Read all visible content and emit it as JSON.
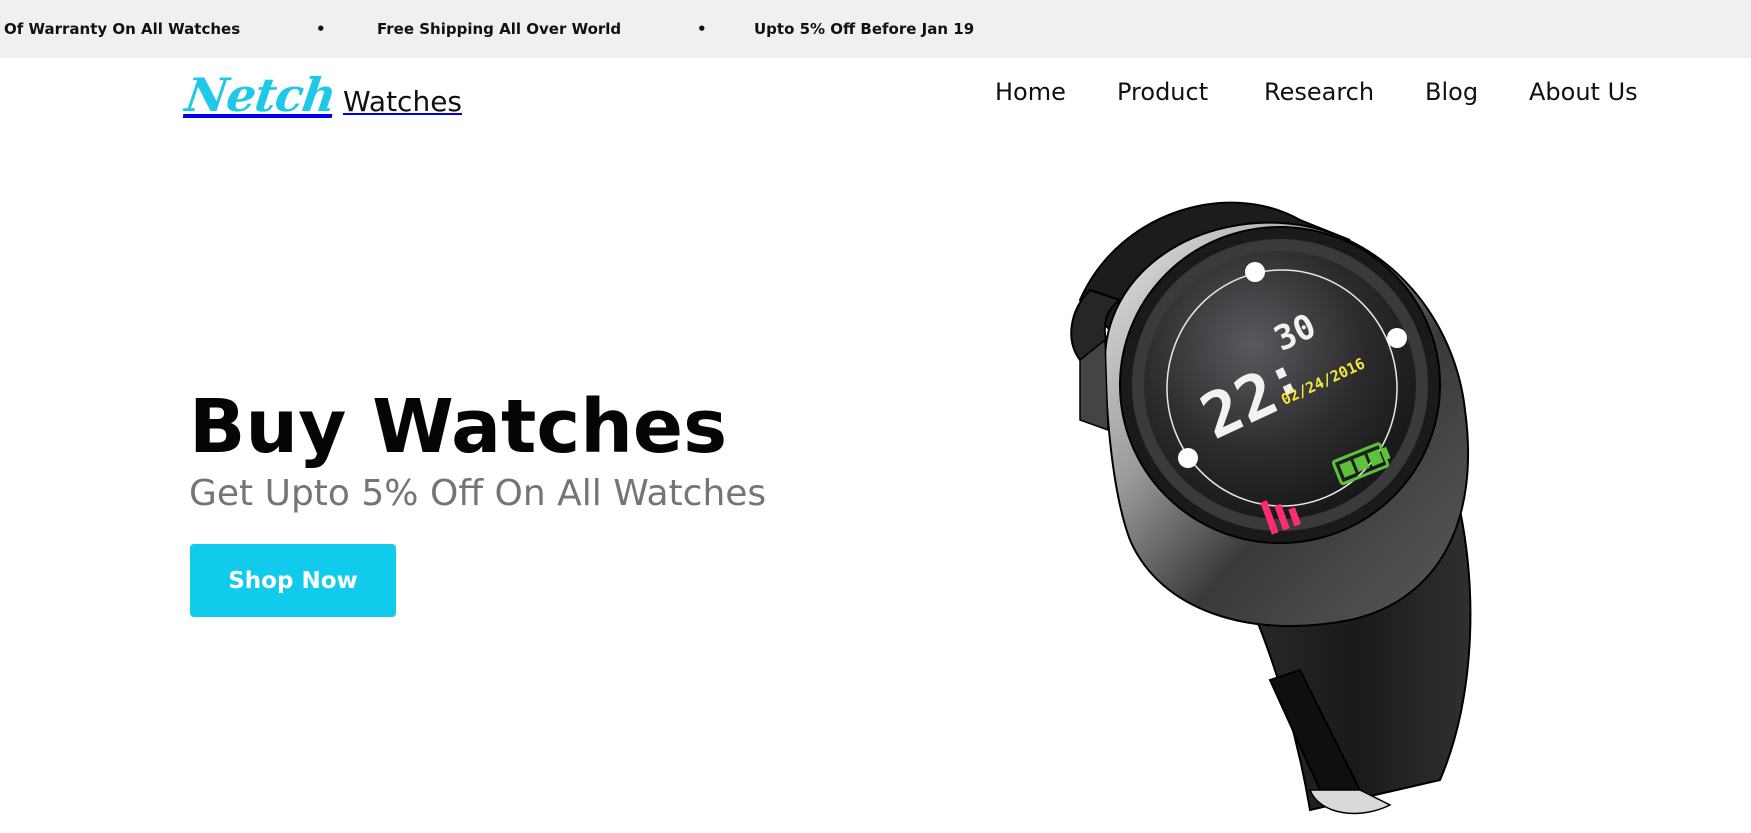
{
  "announcement_bar": {
    "messages": [
      "Of Warranty On All Watches",
      "Free Shipping All Over World",
      "Upto 5% Off Before Jan 19"
    ],
    "separator": "•"
  },
  "header": {
    "logo_script": "Netch",
    "logo_text": "Watches",
    "nav": [
      "Home",
      "Product",
      "Research",
      "Blog",
      "About Us"
    ]
  },
  "hero": {
    "title": "Buy Watches",
    "subtitle": "Get Upto 5% Off On All Watches",
    "cta_label": "Shop Now"
  },
  "watch_display": {
    "hours": "22",
    "separator": ":",
    "minutes": "30",
    "date": "02/24/2016",
    "battery_icon": "battery-icon",
    "activity_icon": "activity-bars-icon"
  },
  "colors": {
    "accent": "#11cbed",
    "logo_blue": "#1ec8e8",
    "announcement_bg": "#f0f0f0",
    "date_yellow": "#f4e63a",
    "battery_green": "#5cc23a",
    "activity_pink": "#ff2d6f"
  }
}
